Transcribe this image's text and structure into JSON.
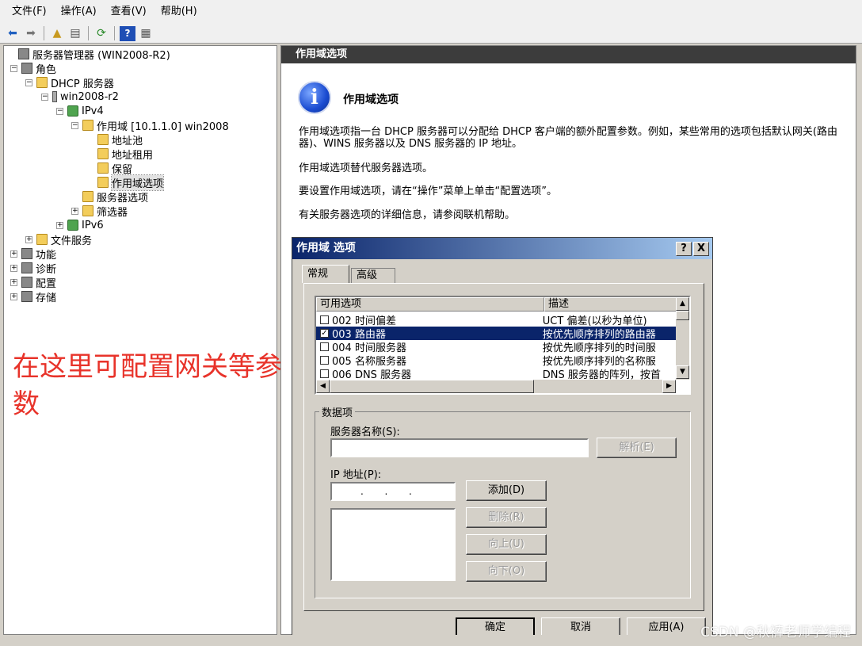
{
  "menu": [
    "文件(F)",
    "操作(A)",
    "查看(V)",
    "帮助(H)"
  ],
  "toolbar_icons": [
    "back-icon",
    "forward-icon",
    "up-icon",
    "show-hide-tree-icon",
    "refresh-icon",
    "help-icon",
    "properties-icon"
  ],
  "tree": {
    "root": "服务器管理器 (WIN2008-R2)",
    "roles": "角色",
    "dhcp": "DHCP 服务器",
    "server": "win2008-r2",
    "ipv4": "IPv4",
    "scope": "作用域 [10.1.1.0] win2008",
    "pool": "地址池",
    "leases": "地址租用",
    "reservations": "保留",
    "scope_options": "作用域选项",
    "server_options": "服务器选项",
    "filters": "筛选器",
    "ipv6": "IPv6",
    "file_services": "文件服务",
    "features": "功能",
    "diagnostics": "诊断",
    "configuration": "配置",
    "storage": "存储"
  },
  "annotation": "在这里可配置网关等参数",
  "right": {
    "header": "作用域选项",
    "title": "作用域选项",
    "p1": "作用域选项指一台 DHCP 服务器可以分配给 DHCP 客户端的额外配置参数。例如，某些常用的选项包括默认网关(路由器)、WINS 服务器以及 DNS 服务器的 IP 地址。",
    "p2": "作用域选项替代服务器选项。",
    "p3": "要设置作用域选项，请在“操作”菜单上单击“配置选项”。",
    "p4": "有关服务器选项的详细信息，请参阅联机帮助。"
  },
  "dialog": {
    "title": "作用域 选项",
    "help_btn": "?",
    "close_btn": "X",
    "tab_general": "常规",
    "tab_advanced": "高级",
    "col_available": "可用选项",
    "col_desc": "描述",
    "options": [
      {
        "check": "",
        "name": "002 时间偏差",
        "desc": "UCT 偏差(以秒为单位)"
      },
      {
        "check": "✓",
        "name": "003 路由器",
        "desc": "按优先顺序排列的路由器"
      },
      {
        "check": "",
        "name": "004 时间服务器",
        "desc": "按优先顺序排列的时间服"
      },
      {
        "check": "",
        "name": "005 名称服务器",
        "desc": "按优先顺序排列的名称服"
      },
      {
        "check": "",
        "name": "006 DNS 服务器",
        "desc": "DNS 服务器的阵列，按首"
      }
    ],
    "data_group": "数据项",
    "server_name_label": "服务器名称(S):",
    "resolve_btn": "解析(E)",
    "ip_label": "IP 地址(P):",
    "ip_value": ".       .       .",
    "add_btn": "添加(D)",
    "remove_btn": "删除(R)",
    "up_btn": "向上(U)",
    "down_btn": "向下(O)",
    "ok_btn": "确定",
    "cancel_btn": "取消",
    "apply_btn": "应用(A)"
  },
  "watermark": "CSDN @秋裤老师学编程"
}
